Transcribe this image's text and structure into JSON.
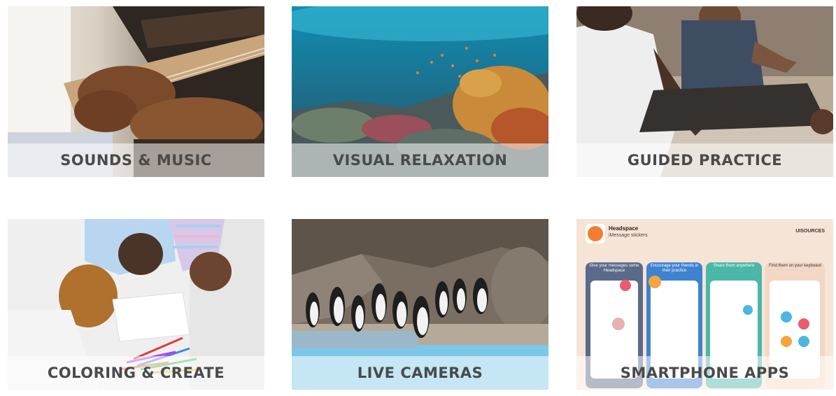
{
  "tiles": [
    {
      "caption": "SOUNDS & MUSIC",
      "image": "guitar-player-photo"
    },
    {
      "caption": "VISUAL RELAXATION",
      "image": "coral-reef-photo"
    },
    {
      "caption": "GUIDED PRACTICE",
      "image": "meditation-photo"
    },
    {
      "caption": "COLORING & CREATE",
      "image": "kids-coloring-photo"
    },
    {
      "caption": "LIVE CAMERAS",
      "image": "penguins-photo"
    },
    {
      "caption": "SMARTPHONE APPS",
      "image": "headspace-app-screenshot",
      "app": {
        "name": "Headspace",
        "subtitle": "iMessage stickers",
        "brand": "UISOURCES",
        "panels": [
          "Give your messages some Headspace",
          "Encourage your friends in their practice",
          "Share them anywhere",
          "Find them on your keyboard"
        ]
      }
    }
  ],
  "colors": {
    "caption_text": "#4a4a4a",
    "caption_band": "rgba(255,255,255,0.55)",
    "headspace_orange": "#f47d31"
  }
}
